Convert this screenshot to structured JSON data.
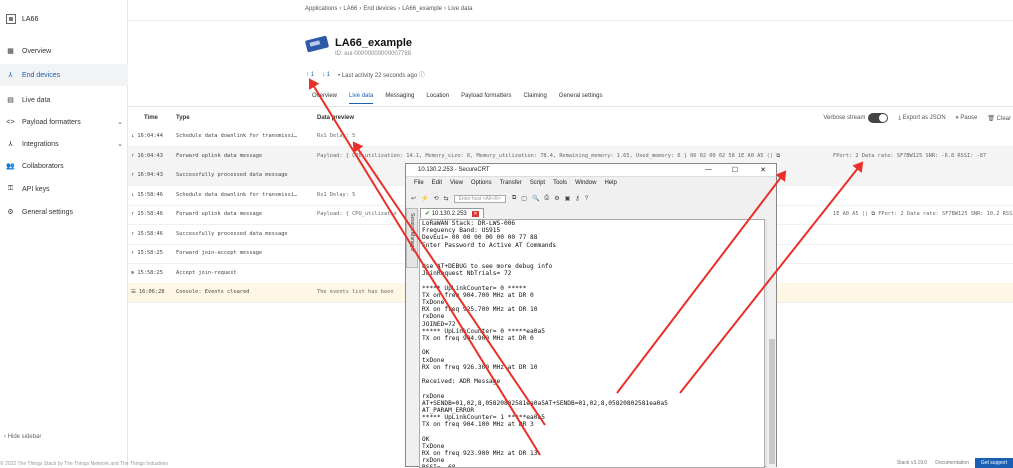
{
  "sidebar": {
    "app_name": "LA66",
    "items": [
      {
        "label": "Overview",
        "icon": "▦"
      },
      {
        "label": "End devices",
        "icon": "⅄",
        "active": true
      },
      {
        "label": "Live data",
        "icon": "▤"
      },
      {
        "label": "Payload formatters",
        "icon": "<>",
        "chevron": "⌄"
      },
      {
        "label": "Integrations",
        "icon": "⅄",
        "chevron": "⌄"
      },
      {
        "label": "Collaborators",
        "icon": "👥"
      },
      {
        "label": "API keys",
        "icon": "⚿"
      },
      {
        "label": "General settings",
        "icon": "⚙"
      }
    ],
    "hide_label": "‹ Hide sidebar",
    "footer": "© 2022 The Things Stack by The Things Network and The Things Industries"
  },
  "breadcrumb": [
    "Applications",
    "›",
    "LA66",
    "›",
    "End devices",
    "›",
    "LA66_example",
    "›",
    "Live data"
  ],
  "device": {
    "title": "LA66_example",
    "id": "ID: eui-00000000000007788",
    "uplinks": "↑ 1",
    "downlinks": "↓ 1",
    "activity": "• Last activity 22 seconds ago ⓘ"
  },
  "tabs": [
    "Overview",
    "Live data",
    "Messaging",
    "Location",
    "Payload formatters",
    "Claiming",
    "General settings"
  ],
  "toolbar": {
    "verbose": "Verbose stream",
    "export": "⤓ Export as JSON",
    "pause": "⏸ Pause",
    "clear": "🗑 Clear"
  },
  "table": {
    "headers": [
      "Time",
      "Type",
      "Data preview"
    ],
    "rows": [
      {
        "time": "↓ 16:04:44",
        "type": "Schedule data downlink for transmissi…",
        "preview": "Rx1 Delay: 5",
        "extra": ""
      },
      {
        "time": "↑ 16:04:43",
        "type": "Forward uplink data message",
        "preview": "Payload: { CPU_utilization: 14.1, Memory_size: 8, Memory_utilization: 78.4, Remaining_memory: 1.65, Used_memory: 6 }   06 02 00 02 58 1E A0 A5  ⟨⟩ ⧉",
        "extra": "FPort: 2  Data rate: SF7BW125  SNR: -6.8  RSSI: -87",
        "hl": true
      },
      {
        "time": "↑ 16:04:43",
        "type": "Successfully processed data message",
        "preview": "",
        "extra": "",
        "hl": true
      },
      {
        "time": "↓ 15:58:46",
        "type": "Schedule data downlink for transmissi…",
        "preview": "Rx1 Delay: 5",
        "extra": ""
      },
      {
        "time": "↑ 15:58:46",
        "type": "Forward uplink data message",
        "preview": "Payload: { CPU_utilizatio",
        "extra": "1E A0 A5  ⟨⟩ ⧉   FPort: 2  Data rate: SF7BW125  SNR: 10.2  RSSI: -84"
      },
      {
        "time": "↑ 15:58:46",
        "type": "Successfully processed data message",
        "preview": "",
        "extra": ""
      },
      {
        "time": "↑ 15:58:25",
        "type": "Forward join-accept message",
        "preview": "",
        "extra": ""
      },
      {
        "time": "⊕ 15:58:25",
        "type": "Accept join-request",
        "preview": "",
        "extra": ""
      },
      {
        "time": "☰ 16:06:28",
        "type": "Console: Events cleared",
        "preview": "The events list has been",
        "extra": "",
        "yel": true
      }
    ]
  },
  "securecrt": {
    "title": "10.130.2.253 - SecureCRT",
    "controls": [
      "—",
      "☐",
      "✕"
    ],
    "menu": [
      "File",
      "Edit",
      "View",
      "Options",
      "Transfer",
      "Script",
      "Tools",
      "Window",
      "Help"
    ],
    "host_placeholder": "Enter host <Alt+R>",
    "tab_label": "10.130.2.253",
    "side_label": "Session Manager",
    "lines": [
      "LoRaWAN Stack: DR-LWS-006",
      "Frequency Band: US915",
      "DevEui= 00 00 00 00 00 00 77 88",
      "Enter Password to Active AT Commands",
      "",
      "",
      "Use AT+DEBUG to see more debug info",
      "JoinRequest NbTrials= 72",
      "",
      "***** UpLinkCounter= 0 *****",
      "TX on freq 904.700 MHz at DR 0",
      "TxDone",
      "RX on freq 925.700 MHz at DR 10",
      "rxDone",
      "JOINED=72",
      "***** UpLinkCounter= 0 *****ea0a5",
      "TX on freq 904.900 MHz at DR 0",
      "",
      "OK",
      "txDone",
      "RX on freq 926.300 MHz at DR 10",
      "",
      "Received: ADR Message",
      "",
      "rxDone",
      "AT+SENDB=01,02,8,05820802581ea0a5AT+SENDB=01,02,8,05820802581ea0a5",
      "AT_PARAM_ERROR",
      "***** UpLinkCounter= 1 *****ea0a5",
      "TX on freq 904.100 MHz at DR 3",
      "",
      "OK",
      "TxDone",
      "RX on freq 923.900 MHz at DR 13",
      "rxDone",
      "RSSI= -68"
    ]
  },
  "bottom_bar": {
    "status": "Stack v3.19.0",
    "docs": "Documentation",
    "support": "Get support"
  },
  "colors": {
    "accent": "#1a5fb4",
    "arrow": "#e8302a"
  }
}
